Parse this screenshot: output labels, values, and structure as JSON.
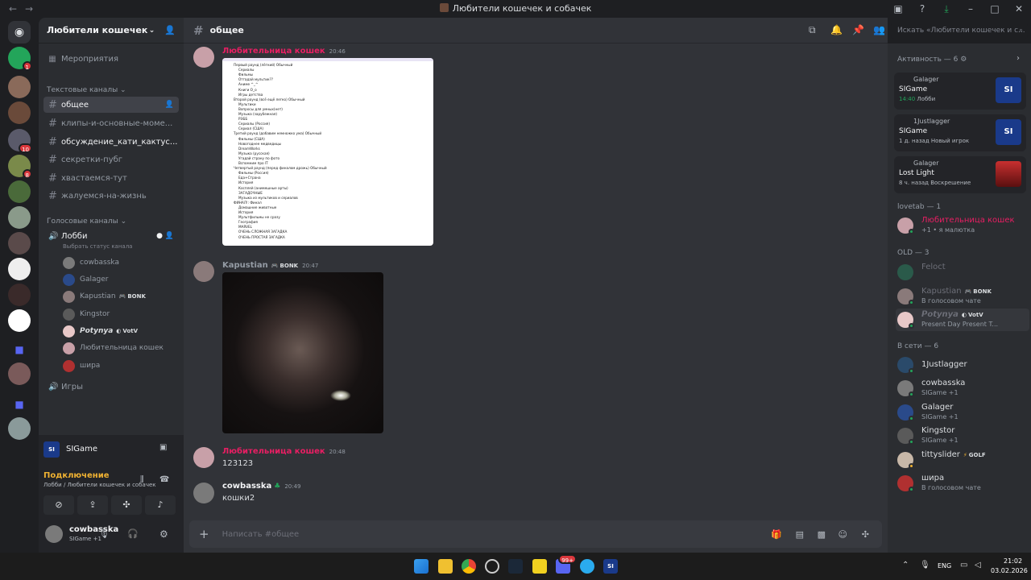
{
  "window": {
    "title": "Любители кошечек и собачек",
    "back": "←",
    "forward": "→"
  },
  "titlebar_icons": [
    "inbox-icon",
    "help-icon",
    "download-icon",
    "minimize-icon",
    "maximize-icon",
    "close-icon"
  ],
  "rail": {
    "badges": [
      "1",
      "10",
      "8"
    ]
  },
  "guild": {
    "name": "Любители кошечек и с...",
    "events": "Мероприятия"
  },
  "categories": {
    "text": "Текстовые каналы",
    "voice": "Голосовые каналы"
  },
  "text_channels": [
    "общее",
    "клипы-и-основные-моме...",
    "обсуждение_кати_кактус...",
    "секретки-пубг",
    "хвастаемся-тут",
    "жалуемся-на-жизнь"
  ],
  "voice": {
    "lobby": "Лобби",
    "lobby_status": "Выбрать статус канала",
    "users": [
      {
        "name": "cowbasska",
        "tag": ""
      },
      {
        "name": "Galager",
        "tag": ""
      },
      {
        "name": "Kapustian",
        "tag": "BONK"
      },
      {
        "name": "Kingstor",
        "tag": ""
      },
      {
        "name": "𝙋𝙤𝙩𝙮𝙣𝙮𝙖",
        "tag": "VotV"
      },
      {
        "name": "Любительница кошек",
        "tag": ""
      },
      {
        "name": "шира",
        "tag": ""
      }
    ],
    "games": "Игры"
  },
  "activity_bar": {
    "game": "SIGame"
  },
  "connection": {
    "status": "Подключение",
    "location": "Лобби / Любители кошечек и собачек"
  },
  "self": {
    "name": "cowbasska",
    "status": "SIGame +1"
  },
  "chat": {
    "channel": "общее",
    "placeholder": "Написать #общее",
    "messages": [
      {
        "author": "Любительница кошек",
        "time": "20:46",
        "text": ""
      },
      {
        "author": "Kapustian",
        "tag": "BONK",
        "time": "20:47",
        "text": ""
      },
      {
        "author": "Любительница кошек",
        "time": "20:48",
        "text": "123123"
      },
      {
        "author": "cowbasska",
        "time": "20:49",
        "text": "кошки2"
      }
    ]
  },
  "doc_lines": [
    "Первый раунд (лёгкий) Обычный",
    "Сериалы",
    "Фильмы",
    "Отгадай мультик??",
    "Аниме ^_^",
    "Книги О_о",
    "Игры детства",
    "Второй раунд (всё ещё легко) Обычный",
    "Мультики",
    "Вопросы для умных(нет)",
    "Музыка (зарубежная)",
    "РЭББ",
    "Сериалы (Россия)",
    "Сериал (США)",
    "Третий раунд (добавим немножко ума) Обычный",
    "Фильмы (США)",
    "Новогоднее медведицы",
    "DreamWorks",
    "Музыка (русская)",
    "Угадай страну по фото",
    "Вспомним про IT",
    "Четвертый раунд (перед финалом дрожь) Обычный",
    "Фильмы (Россия)",
    "Еда+Страна",
    "История",
    "Косплей (анимешные арты)",
    "ЗАГАДОЧНЫЕ",
    "Музыка из мультиков и сериалов",
    "ФИНАЛ!: Финал",
    "Домашние животные",
    "История",
    "Мультфильмы не сразу",
    "География",
    "MARVEL",
    "ОЧЕНЬ СЛОЖНАЯ ЗАГАДКА",
    "ОЧЕНЬ ПРОСТАЯ ЗАГАДКА"
  ],
  "search": {
    "placeholder": "Искать «Любители кошечек и с..."
  },
  "members": {
    "activity_header": "Активность — 6",
    "activities": [
      {
        "user": "Galager",
        "game": "SIGame",
        "meta": "14:40",
        "place": "Лобби"
      },
      {
        "user": "1Justlagger",
        "game": "SIGame",
        "meta": "1 д. назад",
        "place": "Новый игрок"
      },
      {
        "user": "Galager",
        "game": "Lost Light",
        "meta": "8 ч. назад",
        "place": "Воскрешение"
      }
    ],
    "lovetab_header": "lovetab — 1",
    "lovetab": [
      {
        "name": "Любительница кошек",
        "sub": "+1 • я малютка"
      }
    ],
    "old_header": "OLD — 3",
    "old": [
      {
        "name": "Feloct",
        "sub": ""
      },
      {
        "name": "Kapustian",
        "tag": "BONK",
        "sub": "В голосовом чате"
      },
      {
        "name": "𝙋𝙤𝙩𝙮𝙣𝙮𝙖",
        "tag": "VotV",
        "sub": "Present Day Present T..."
      }
    ],
    "online_header": "В сети — 6",
    "online": [
      {
        "name": "1Justlagger",
        "sub": ""
      },
      {
        "name": "cowbasska",
        "sub": "SIGame +1"
      },
      {
        "name": "Galager",
        "sub": "SIGame +1"
      },
      {
        "name": "Kingstor",
        "sub": "SIGame +1"
      },
      {
        "name": "tittyslider",
        "tag": "GOLF",
        "sub": ""
      },
      {
        "name": "шира",
        "sub": "В голосовом чате"
      }
    ]
  },
  "taskbar": {
    "lang": "ENG",
    "time": "21:02",
    "date": "03.02.2026",
    "badge": "99+"
  }
}
